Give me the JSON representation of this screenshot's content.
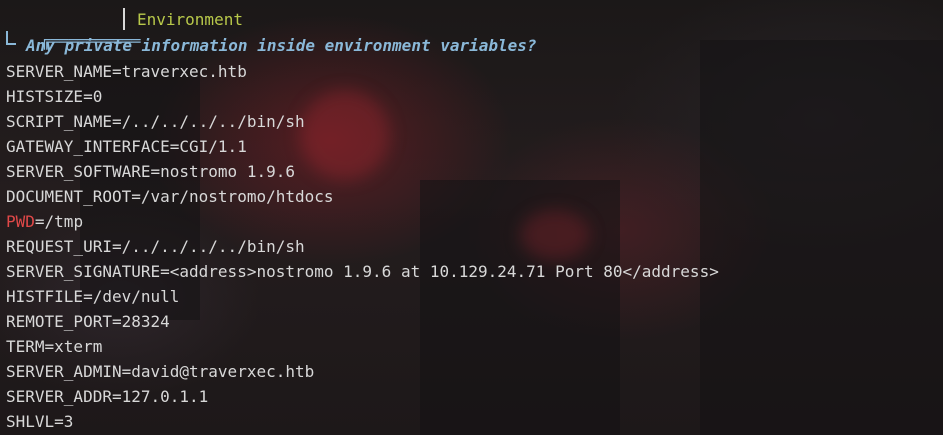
{
  "section": {
    "box": "╔══════════",
    "title": "Environment",
    "question": "Any private information inside environment variables?"
  },
  "env": {
    "l1": "SERVER_NAME=traverxec.htb",
    "l2": "HISTSIZE=0",
    "l3": "SCRIPT_NAME=/../../../../bin/sh",
    "l4": "GATEWAY_INTERFACE=CGI/1.1",
    "l5": "SERVER_SOFTWARE=nostromo 1.9.6",
    "l6": "DOCUMENT_ROOT=/var/nostromo/htdocs",
    "l7_key": "PWD",
    "l7_rest": "=/tmp",
    "l8": "REQUEST_URI=/../../../../bin/sh",
    "l9": "SERVER_SIGNATURE=<address>nostromo 1.9.6 at 10.129.24.71 Port 80</address>",
    "l10": "HISTFILE=/dev/null",
    "l11": "REMOTE_PORT=28324",
    "l12": "TERM=xterm",
    "l13": "SERVER_ADMIN=david@traverxec.htb",
    "l14": "SERVER_ADDR=127.0.1.1",
    "l15": "SHLVL=3"
  },
  "colors": {
    "header_box": "#8ab8d8",
    "title": "#b8c84a",
    "text": "#d8d8d8",
    "highlight": "#e04848"
  }
}
